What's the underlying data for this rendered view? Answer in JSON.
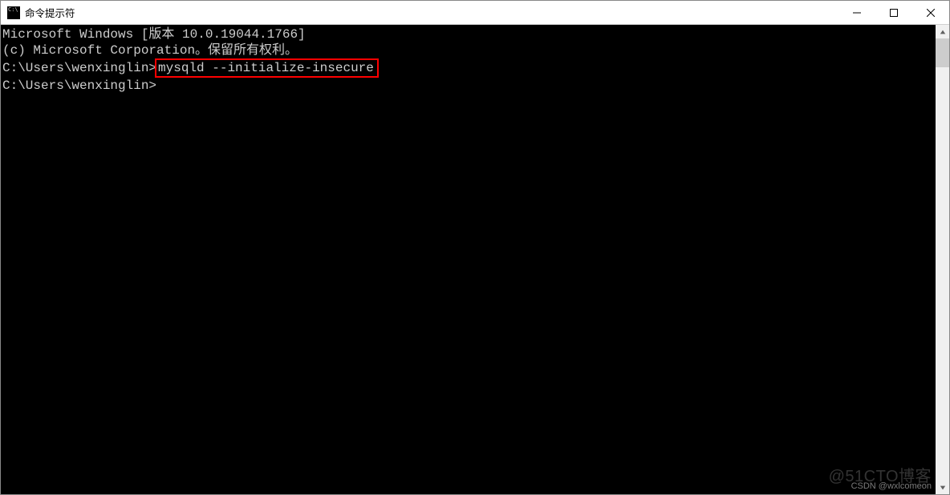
{
  "titlebar": {
    "title": "命令提示符"
  },
  "terminal": {
    "line1": "Microsoft Windows [版本 10.0.19044.1766]",
    "line2": "(c) Microsoft Corporation。保留所有权利。",
    "blank1": "",
    "prompt1_prefix": "C:\\Users\\wenxinglin>",
    "prompt1_cmd": "mysqld --initialize-insecure",
    "blank2": "",
    "prompt2": "C:\\Users\\wenxinglin>"
  },
  "watermarks": {
    "main": "@51CTO博客",
    "csdn": "CSDN @wxlcomeon"
  }
}
